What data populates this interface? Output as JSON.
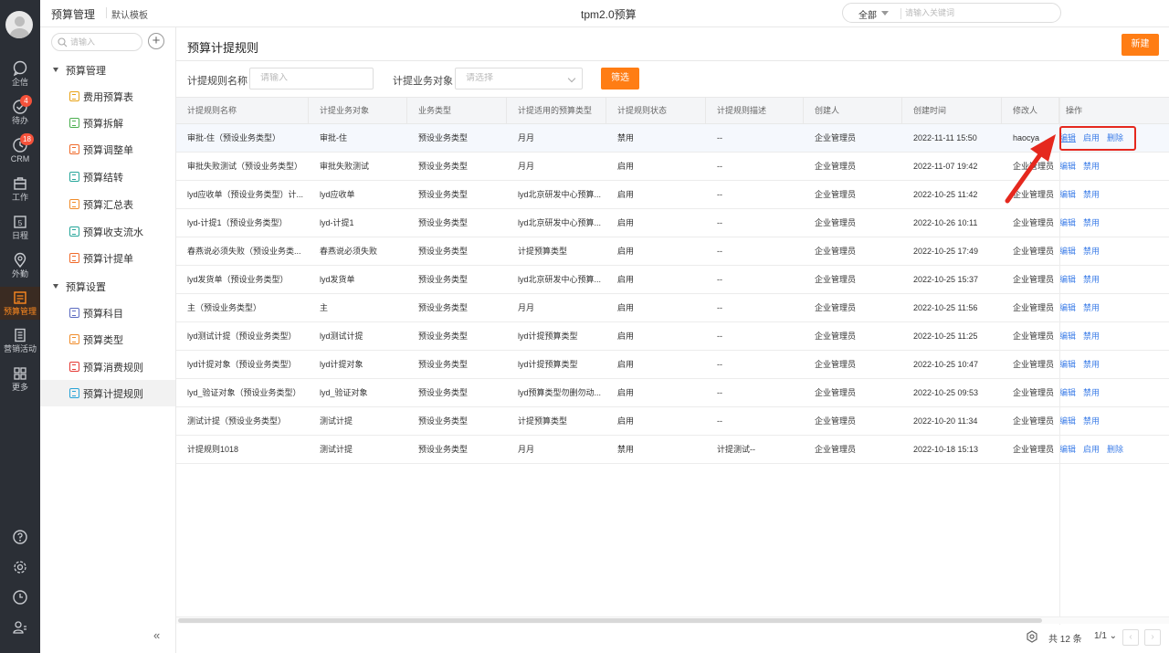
{
  "rail": {
    "items": [
      {
        "label": "企信",
        "icon": "chat-icon"
      },
      {
        "label": "待办",
        "icon": "todo-check-icon",
        "badge": "4"
      },
      {
        "label": "CRM",
        "icon": "crm-clock-icon",
        "badge": "18"
      },
      {
        "label": "工作",
        "icon": "briefcase-icon"
      },
      {
        "label": "日程",
        "icon": "calendar-icon",
        "date": "5"
      },
      {
        "label": "外勤",
        "icon": "location-pin-icon"
      },
      {
        "label": "预算管理",
        "icon": "budget-icon"
      },
      {
        "label": "营销活动",
        "icon": "marketing-icon"
      },
      {
        "label": "更多",
        "icon": "grid-more-icon"
      }
    ],
    "accent": "#ff8a1f"
  },
  "topbar": {
    "title": "预算管理",
    "template": "默认模板",
    "app_name": "tpm2.0预算",
    "search_scope": "全部",
    "search_placeholder": "请输入关键词"
  },
  "sidebar": {
    "search_placeholder": "请输入",
    "groups": [
      {
        "label": "预算管理",
        "items": [
          "费用预算表",
          "预算拆解",
          "预算调整单",
          "预算结转",
          "预算汇总表",
          "预算收支流水",
          "预算计提单"
        ]
      },
      {
        "label": "预算设置",
        "items": [
          "预算科目",
          "预算类型",
          "预算消费规则",
          "预算计提规则"
        ]
      }
    ],
    "active_item": "预算计提规则",
    "collapse_label": "«"
  },
  "main": {
    "title": "预算计提规则",
    "new_button": "新建",
    "filters": {
      "name_label": "计提规则名称",
      "name_placeholder": "请输入",
      "object_label": "计提业务对象",
      "object_placeholder": "请选择",
      "filter_button": "筛选"
    },
    "columns": [
      "计提规则名称",
      "计提业务对象",
      "业务类型",
      "计提适用的预算类型",
      "计提规则状态",
      "计提规则描述",
      "创建人",
      "创建时间",
      "修改人",
      "操作"
    ],
    "rows": [
      {
        "name": "审批-住（预设业务类型）",
        "object": "审批-住",
        "type": "预设业务类型",
        "budget_type": "月月",
        "status": "禁用",
        "desc": "--",
        "creator": "企业管理员",
        "created": "2022-11-11 15:50",
        "modifier": "haocya",
        "ops": [
          "编辑",
          "启用",
          "删除"
        ]
      },
      {
        "name": "审批失败测试（预设业务类型）",
        "object": "审批失败测试",
        "type": "预设业务类型",
        "budget_type": "月月",
        "status": "启用",
        "desc": "--",
        "creator": "企业管理员",
        "created": "2022-11-07 19:42",
        "modifier": "企业管理员",
        "ops": [
          "编辑",
          "禁用"
        ]
      },
      {
        "name": "lyd应收单（预设业务类型）计...",
        "object": "lyd应收单",
        "type": "预设业务类型",
        "budget_type": "lyd北京研发中心预算...",
        "status": "启用",
        "desc": "--",
        "creator": "企业管理员",
        "created": "2022-10-25 11:42",
        "modifier": "企业管理员",
        "ops": [
          "编辑",
          "禁用"
        ]
      },
      {
        "name": "lyd-计提1（预设业务类型）",
        "object": "lyd-计提1",
        "type": "预设业务类型",
        "budget_type": "lyd北京研发中心预算...",
        "status": "启用",
        "desc": "--",
        "creator": "企业管理员",
        "created": "2022-10-26 10:11",
        "modifier": "企业管理员",
        "ops": [
          "编辑",
          "禁用"
        ]
      },
      {
        "name": "春燕说必须失败（预设业务类...",
        "object": "春燕说必须失败",
        "type": "预设业务类型",
        "budget_type": "计提预算类型",
        "status": "启用",
        "desc": "--",
        "creator": "企业管理员",
        "created": "2022-10-25 17:49",
        "modifier": "企业管理员",
        "ops": [
          "编辑",
          "禁用"
        ]
      },
      {
        "name": "lyd发货单（预设业务类型）",
        "object": "lyd发货单",
        "type": "预设业务类型",
        "budget_type": "lyd北京研发中心预算...",
        "status": "启用",
        "desc": "--",
        "creator": "企业管理员",
        "created": "2022-10-25 15:37",
        "modifier": "企业管理员",
        "ops": [
          "编辑",
          "禁用"
        ]
      },
      {
        "name": "主（预设业务类型）",
        "object": "主",
        "type": "预设业务类型",
        "budget_type": "月月",
        "status": "启用",
        "desc": "--",
        "creator": "企业管理员",
        "created": "2022-10-25 11:56",
        "modifier": "企业管理员",
        "ops": [
          "编辑",
          "禁用"
        ]
      },
      {
        "name": "lyd测试计提（预设业务类型）",
        "object": "lyd测试计提",
        "type": "预设业务类型",
        "budget_type": "lyd计提预算类型",
        "status": "启用",
        "desc": "--",
        "creator": "企业管理员",
        "created": "2022-10-25 11:25",
        "modifier": "企业管理员",
        "ops": [
          "编辑",
          "禁用"
        ]
      },
      {
        "name": "lyd计提对象（预设业务类型）",
        "object": "lyd计提对象",
        "type": "预设业务类型",
        "budget_type": "lyd计提预算类型",
        "status": "启用",
        "desc": "--",
        "creator": "企业管理员",
        "created": "2022-10-25 10:47",
        "modifier": "企业管理员",
        "ops": [
          "编辑",
          "禁用"
        ]
      },
      {
        "name": "lyd_验证对象（预设业务类型）",
        "object": "lyd_验证对象",
        "type": "预设业务类型",
        "budget_type": "lyd预算类型勿删勿动...",
        "status": "启用",
        "desc": "--",
        "creator": "企业管理员",
        "created": "2022-10-25 09:53",
        "modifier": "企业管理员",
        "ops": [
          "编辑",
          "禁用"
        ]
      },
      {
        "name": "测试计提（预设业务类型）",
        "object": "测试计提",
        "type": "预设业务类型",
        "budget_type": "计提预算类型",
        "status": "启用",
        "desc": "--",
        "creator": "企业管理员",
        "created": "2022-10-20 11:34",
        "modifier": "企业管理员",
        "ops": [
          "编辑",
          "禁用"
        ]
      },
      {
        "name": "计提规则1018",
        "object": "测试计提",
        "type": "预设业务类型",
        "budget_type": "月月",
        "status": "禁用",
        "desc": "计提测试--",
        "creator": "企业管理员",
        "created": "2022-10-18 15:13",
        "modifier": "企业管理员",
        "ops": [
          "编辑",
          "启用",
          "删除"
        ]
      }
    ],
    "footer": {
      "total": "共 12 条",
      "page": "1/1"
    },
    "highlight_color": "#e5281e",
    "link_color": "#3d7ee8",
    "button_color": "#ff7d14"
  }
}
